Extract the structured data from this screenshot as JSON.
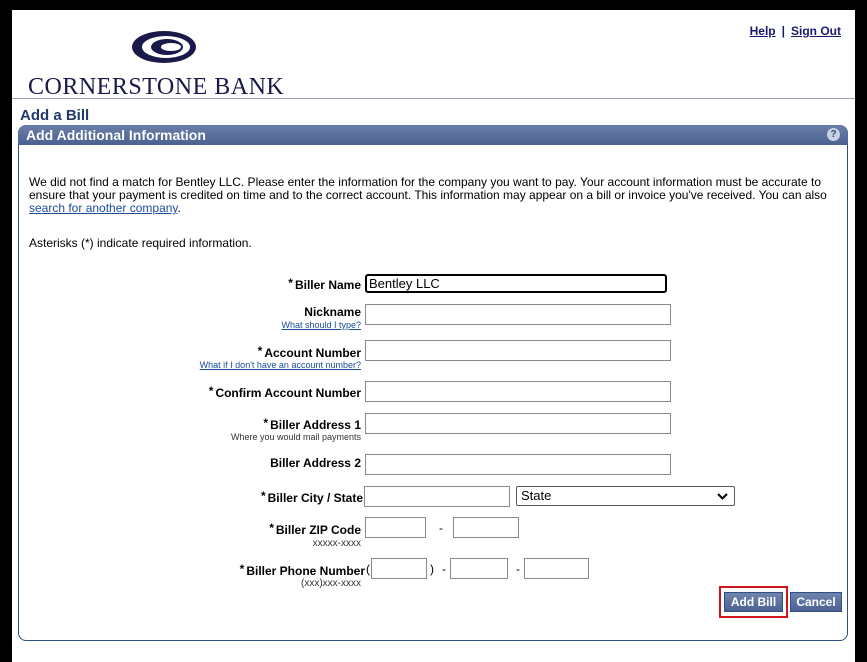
{
  "header": {
    "bank_name": "CORNERSTONE BANK",
    "help_link": "Help",
    "separator": "|",
    "signout_link": "Sign Out"
  },
  "page": {
    "title": "Add a Bill",
    "panel_title": "Add Additional Information",
    "help_icon": "?"
  },
  "intro": {
    "text_before_link": "We did not find a match for Bentley LLC. Please enter the information for the company you want to pay. Your account information must be accurate to ensure that your payment is credited on time and to the correct account. This information may appear on a bill or invoice you've received. You can also ",
    "link": "search for another company",
    "text_after_link": ".",
    "asterisk_note": "Asterisks (*) indicate required information."
  },
  "form": {
    "biller_name": {
      "label": "Biller Name",
      "value": "Bentley LLC"
    },
    "nickname": {
      "label": "Nickname",
      "help": "What should I type?",
      "value": ""
    },
    "account_number": {
      "label": "Account Number",
      "help": "What if I don't have an account number?",
      "value": ""
    },
    "confirm_account": {
      "label": "Confirm Account Number",
      "value": ""
    },
    "address1": {
      "label": "Biller Address 1",
      "hint": "Where you would mail payments",
      "value": ""
    },
    "address2": {
      "label": "Biller Address 2",
      "value": ""
    },
    "city_state": {
      "label": "Biller City / State",
      "city_value": "",
      "state_value": "State"
    },
    "zip": {
      "label": "Biller ZIP Code",
      "hint": "xxxxx-xxxx",
      "dash": "-"
    },
    "phone": {
      "label": "Biller Phone Number",
      "hint": "(xxx)xxx-xxxx",
      "open_paren": "(",
      "close_paren": ")",
      "dash": "-"
    },
    "required_mark": "*"
  },
  "buttons": {
    "add_bill": "Add Bill",
    "cancel": "Cancel"
  },
  "icons": {
    "logo": "cornerstone-logo-icon",
    "help": "question-icon",
    "dropdown": "chevron-down-icon"
  },
  "colors": {
    "panel_header": "#4b6191",
    "brand_navy": "#1a1a4a",
    "highlight": "#d0141c"
  }
}
